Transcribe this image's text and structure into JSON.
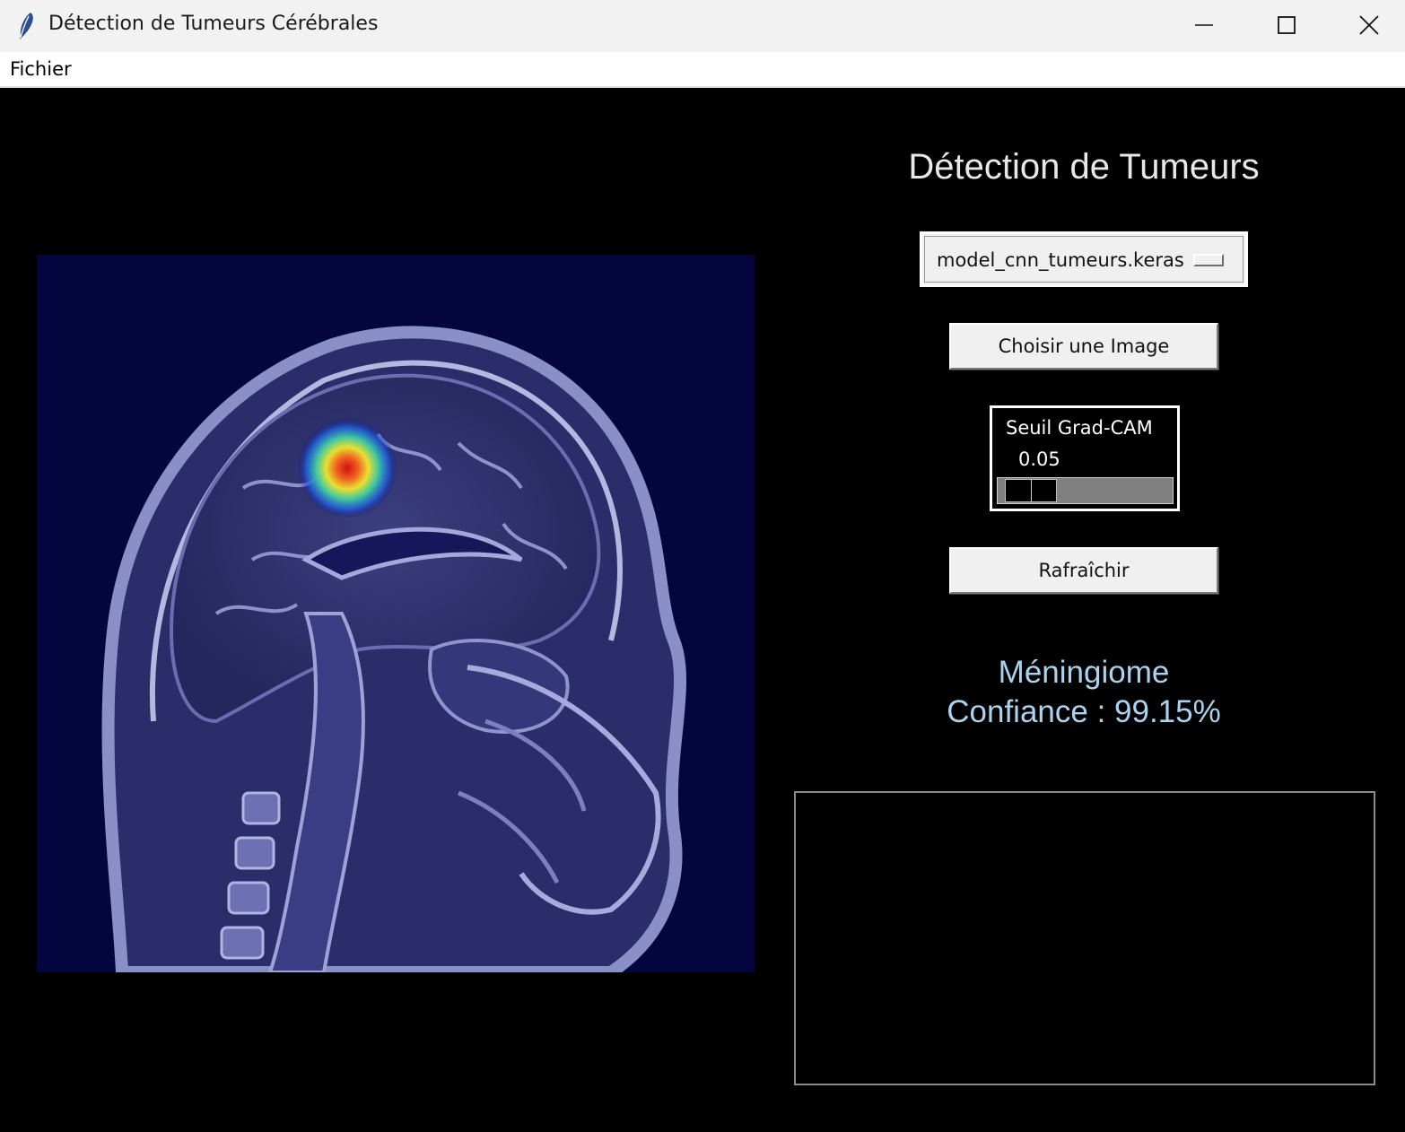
{
  "window": {
    "title": "Détection de Tumeurs Cérébrales",
    "app_icon": "feather-icon",
    "controls": {
      "minimize": "minimize-icon",
      "maximize": "maximize-icon",
      "close": "close-icon"
    }
  },
  "menubar": {
    "items": [
      {
        "label": "Fichier"
      }
    ]
  },
  "panel": {
    "title": "Détection de Tumeurs",
    "model_select": {
      "selected": "model_cnn_tumeurs.keras"
    },
    "choose_button": "Choisir une Image",
    "threshold": {
      "label": "Seuil Grad-CAM",
      "value_text": "0.05",
      "value": 0.05,
      "min": 0.0,
      "max": 1.0
    },
    "refresh_button": "Rafraîchir",
    "result": {
      "class_label": "Méningiome",
      "confidence_text": "Confiance : 99.15%"
    }
  },
  "colors": {
    "background": "#000000",
    "result_text": "#a9d3ee",
    "title_text": "#e8e8e8",
    "mri_tint": "#04053f"
  }
}
